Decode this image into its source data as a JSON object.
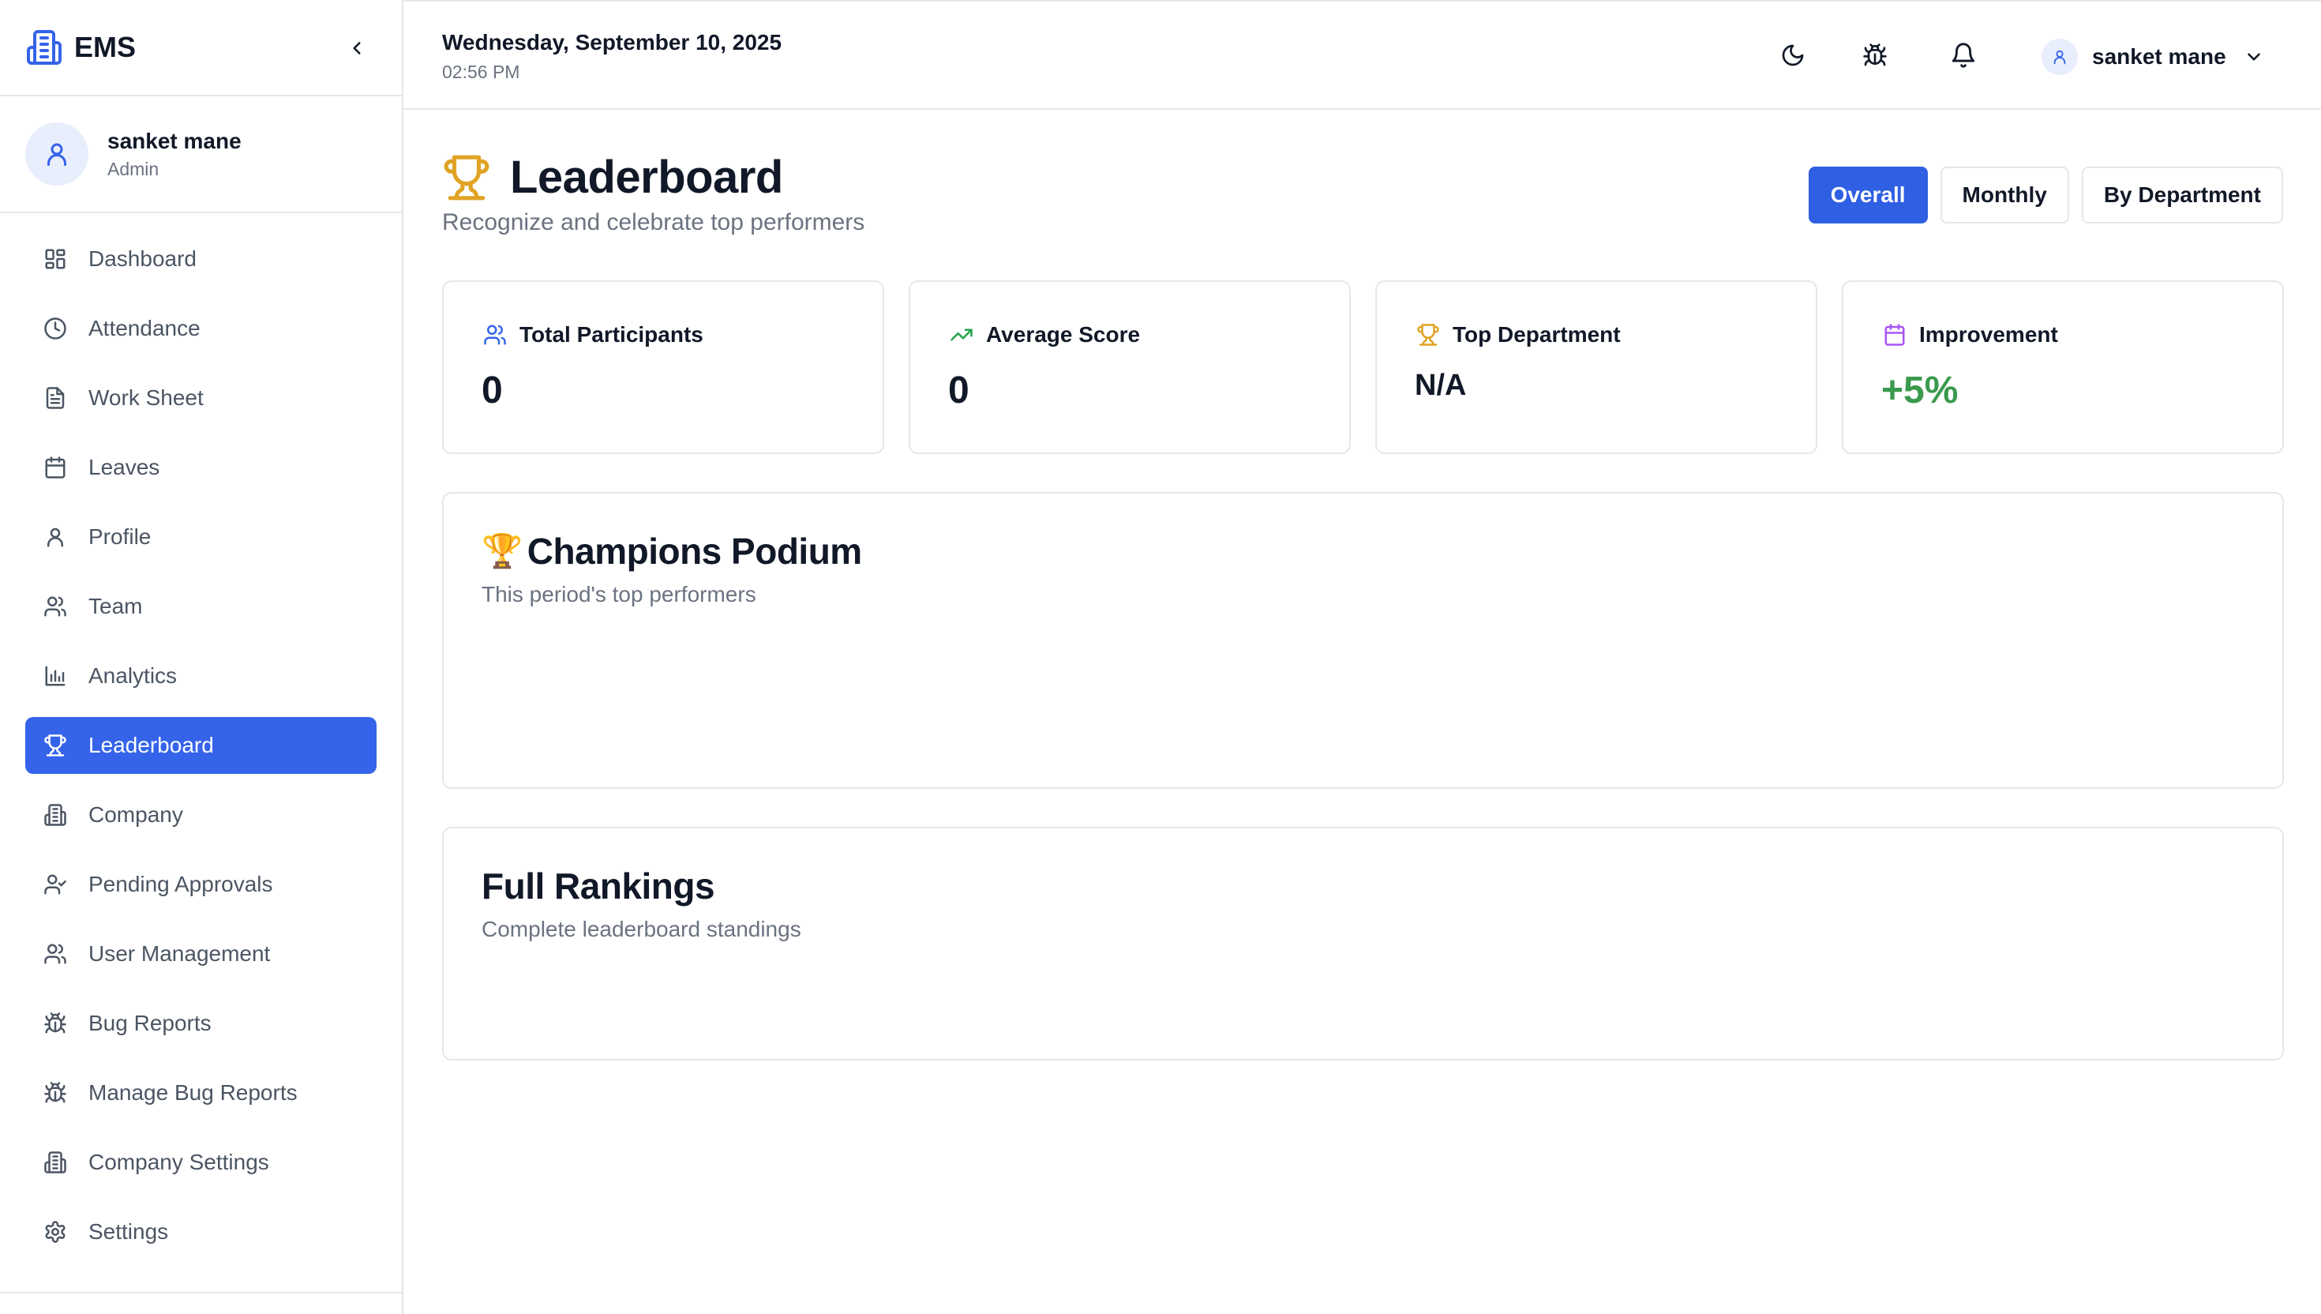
{
  "brand": {
    "name": "EMS",
    "icon": "building-icon"
  },
  "sidebar_user": {
    "name": "sanket mane",
    "role": "Admin"
  },
  "sidebar": {
    "items": [
      {
        "label": "Dashboard",
        "icon": "dashboard-icon"
      },
      {
        "label": "Attendance",
        "icon": "clock-icon"
      },
      {
        "label": "Work Sheet",
        "icon": "file-icon"
      },
      {
        "label": "Leaves",
        "icon": "calendar-icon"
      },
      {
        "label": "Profile",
        "icon": "user-icon"
      },
      {
        "label": "Team",
        "icon": "users-icon"
      },
      {
        "label": "Analytics",
        "icon": "bar-chart-icon"
      },
      {
        "label": "Leaderboard",
        "icon": "trophy-icon",
        "active": true
      },
      {
        "label": "Company",
        "icon": "building-icon"
      },
      {
        "label": "Pending Approvals",
        "icon": "user-check-icon"
      },
      {
        "label": "User Management",
        "icon": "users-icon"
      },
      {
        "label": "Bug Reports",
        "icon": "bug-icon"
      },
      {
        "label": "Manage Bug Reports",
        "icon": "bug-icon"
      },
      {
        "label": "Company Settings",
        "icon": "building-icon"
      },
      {
        "label": "Settings",
        "icon": "gear-icon"
      }
    ]
  },
  "header": {
    "date": "Wednesday, September 10, 2025",
    "time": "02:56 PM",
    "user_name": "sanket mane"
  },
  "page": {
    "title": "Leaderboard",
    "subtitle": "Recognize and celebrate top performers",
    "tabs": [
      "Overall",
      "Monthly",
      "By Department"
    ],
    "active_tab": "Overall"
  },
  "stats": [
    {
      "label": "Total Participants",
      "value": "0",
      "icon": "users-icon",
      "color": "#3563e9"
    },
    {
      "label": "Average Score",
      "value": "0",
      "icon": "trending-up-icon",
      "color": "#22a34a"
    },
    {
      "label": "Top Department",
      "value": "N/A",
      "icon": "trophy-icon",
      "color": "#e0a324"
    },
    {
      "label": "Improvement",
      "value": "+5%",
      "icon": "calendar-icon",
      "color": "#a855f7"
    }
  ],
  "podium": {
    "title": "Champions Podium",
    "emoji": "🏆",
    "subtitle": "This period's top performers"
  },
  "rankings": {
    "title": "Full Rankings",
    "subtitle": "Complete leaderboard standings"
  },
  "colors": {
    "accent": "#3563e9",
    "positive": "#3a9a4d",
    "trophy": "#e0a324"
  }
}
